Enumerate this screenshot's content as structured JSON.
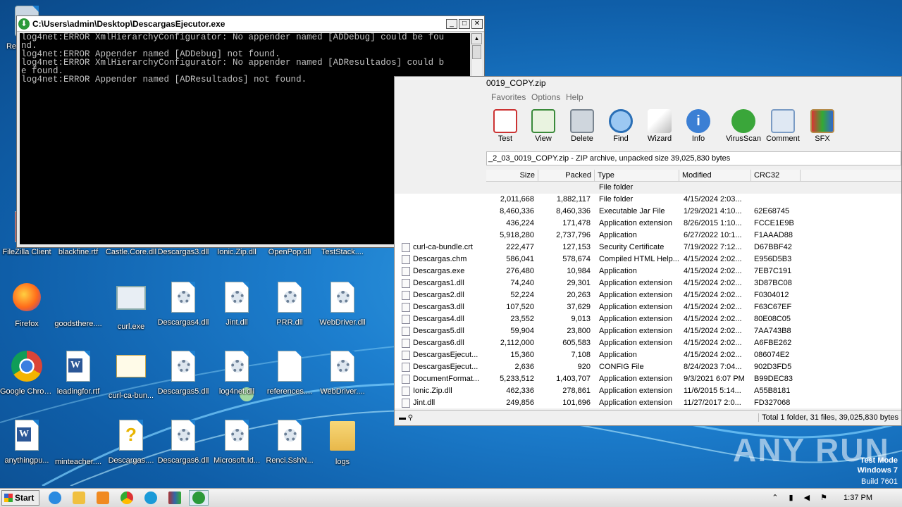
{
  "console": {
    "title": "C:\\Users\\admin\\Desktop\\DescargasEjecutor.exe",
    "output": "log4net:ERROR XmlHierarchyConfigurator: No appender named [ADDebug] could be fou\nnd.\nlog4net:ERROR Appender named [ADDebug] not found.\nlog4net:ERROR XmlHierarchyConfigurator: No appender named [ADResultados] could b\ne found.\nlog4net:ERROR Appender named [ADResultados] not found.",
    "buttons": [
      "_",
      "□",
      "✕"
    ]
  },
  "winrar": {
    "title": "0019_COPY.zip",
    "menu": [
      "Favorites",
      "Options",
      "Help"
    ],
    "toolbar": [
      "Test",
      "View",
      "Delete",
      "Find",
      "Wizard",
      "Info",
      "VirusScan",
      "Comment",
      "SFX"
    ],
    "path": "_2_03_0019_COPY.zip - ZIP archive, unpacked size 39,025,830 bytes",
    "columns": [
      "Size",
      "Packed",
      "Type",
      "Modified",
      "CRC32"
    ],
    "rows": [
      {
        "name": "",
        "size": "",
        "packed": "",
        "type": "File folder",
        "modified": "",
        "crc": ""
      },
      {
        "name": "",
        "size": "2,011,668",
        "packed": "1,882,117",
        "type": "File folder",
        "modified": "4/15/2024 2:03...",
        "crc": ""
      },
      {
        "name": "",
        "size": "8,460,336",
        "packed": "8,460,336",
        "type": "Executable Jar File",
        "modified": "1/29/2021 4:10...",
        "crc": "62E68745"
      },
      {
        "name": "",
        "size": "436,224",
        "packed": "171,478",
        "type": "Application extension",
        "modified": "8/26/2015 1:10...",
        "crc": "FCCE1E9B"
      },
      {
        "name": "",
        "size": "5,918,280",
        "packed": "2,737,796",
        "type": "Application",
        "modified": "6/27/2022 10:1...",
        "crc": "F1AAAD88"
      },
      {
        "name": "curl-ca-bundle.crt",
        "size": "222,477",
        "packed": "127,153",
        "type": "Security Certificate",
        "modified": "7/19/2022 7:12...",
        "crc": "D67BBF42"
      },
      {
        "name": "Descargas.chm",
        "size": "586,041",
        "packed": "578,674",
        "type": "Compiled HTML Help...",
        "modified": "4/15/2024 2:02...",
        "crc": "E956D5B3"
      },
      {
        "name": "Descargas.exe",
        "size": "276,480",
        "packed": "10,984",
        "type": "Application",
        "modified": "4/15/2024 2:02...",
        "crc": "7EB7C191"
      },
      {
        "name": "Descargas1.dll",
        "size": "74,240",
        "packed": "29,301",
        "type": "Application extension",
        "modified": "4/15/2024 2:02...",
        "crc": "3D87BC08"
      },
      {
        "name": "Descargas2.dll",
        "size": "52,224",
        "packed": "20,263",
        "type": "Application extension",
        "modified": "4/15/2024 2:02...",
        "crc": "F0304012"
      },
      {
        "name": "Descargas3.dll",
        "size": "107,520",
        "packed": "37,629",
        "type": "Application extension",
        "modified": "4/15/2024 2:02...",
        "crc": "F63C67EF"
      },
      {
        "name": "Descargas4.dll",
        "size": "23,552",
        "packed": "9,013",
        "type": "Application extension",
        "modified": "4/15/2024 2:02...",
        "crc": "80E08C05"
      },
      {
        "name": "Descargas5.dll",
        "size": "59,904",
        "packed": "23,800",
        "type": "Application extension",
        "modified": "4/15/2024 2:02...",
        "crc": "7AA743B8"
      },
      {
        "name": "Descargas6.dll",
        "size": "2,112,000",
        "packed": "605,583",
        "type": "Application extension",
        "modified": "4/15/2024 2:02...",
        "crc": "A6FBE262"
      },
      {
        "name": "DescargasEjecut...",
        "size": "15,360",
        "packed": "7,108",
        "type": "Application",
        "modified": "4/15/2024 2:02...",
        "crc": "086074E2"
      },
      {
        "name": "DescargasEjecut...",
        "size": "2,636",
        "packed": "920",
        "type": "CONFIG File",
        "modified": "8/24/2023 7:04...",
        "crc": "902D3FD5"
      },
      {
        "name": "DocumentFormat...",
        "size": "5,233,512",
        "packed": "1,403,707",
        "type": "Application extension",
        "modified": "9/3/2021 6:07 PM",
        "crc": "B99DEC83"
      },
      {
        "name": "Ionic.Zip.dll",
        "size": "462,336",
        "packed": "278,861",
        "type": "Application extension",
        "modified": "11/6/2015 5:14...",
        "crc": "A55B8181"
      },
      {
        "name": "Jint.dll",
        "size": "249,856",
        "packed": "101,696",
        "type": "Application extension",
        "modified": "11/27/2017 2:0...",
        "crc": "FD327068"
      }
    ],
    "status": "Total 1 folder, 31 files, 39,025,830 bytes"
  },
  "desktop": {
    "icons": [
      {
        "label": "Recycle Bin",
        "kind": "bin",
        "col": 0,
        "row": 0
      },
      {
        "label": "FileZilla Client",
        "kind": "app",
        "col": 0,
        "row": 3
      },
      {
        "label": "blackfine.rtf",
        "kind": "doc",
        "col": 1,
        "row": 3
      },
      {
        "label": "Castle.Core.dll",
        "kind": "dll",
        "col": 2,
        "row": 3
      },
      {
        "label": "Descargas3.dll",
        "kind": "dll",
        "col": 3,
        "row": 3
      },
      {
        "label": "Ionic.Zip.dll",
        "kind": "dll",
        "col": 4,
        "row": 3
      },
      {
        "label": "OpenPop.dll",
        "kind": "dll",
        "col": 5,
        "row": 3
      },
      {
        "label": "TestStack....",
        "kind": "dll",
        "col": 6,
        "row": 3
      },
      {
        "label": "Firefox",
        "kind": "firefox",
        "col": 0,
        "row": 4
      },
      {
        "label": "goodsthere....",
        "kind": "blank",
        "col": 1,
        "row": 4
      },
      {
        "label": "curl.exe",
        "kind": "exe",
        "col": 2,
        "row": 4
      },
      {
        "label": "Descargas4.dll",
        "kind": "dll",
        "col": 3,
        "row": 4
      },
      {
        "label": "Jint.dll",
        "kind": "dll",
        "col": 4,
        "row": 4
      },
      {
        "label": "PRR.dll",
        "kind": "dll",
        "col": 5,
        "row": 4
      },
      {
        "label": "WebDriver.dll",
        "kind": "dll",
        "col": 6,
        "row": 4
      },
      {
        "label": "Google Chrome",
        "kind": "chrome",
        "col": 0,
        "row": 5
      },
      {
        "label": "leadingfor.rtf",
        "kind": "word",
        "col": 1,
        "row": 5
      },
      {
        "label": "curl-ca-bun...",
        "kind": "cert",
        "col": 2,
        "row": 5
      },
      {
        "label": "Descargas5.dll",
        "kind": "dll",
        "col": 3,
        "row": 5
      },
      {
        "label": "log4net.dll",
        "kind": "dll",
        "col": 4,
        "row": 5
      },
      {
        "label": "references....",
        "kind": "doc",
        "col": 5,
        "row": 5
      },
      {
        "label": "WebDriver....",
        "kind": "dll",
        "col": 6,
        "row": 5
      },
      {
        "label": "anythingpu...",
        "kind": "word",
        "col": 0,
        "row": 6
      },
      {
        "label": "minteacher....",
        "kind": "blank",
        "col": 1,
        "row": 6
      },
      {
        "label": "Descargas....",
        "kind": "help",
        "col": 2,
        "row": 6
      },
      {
        "label": "Descargas6.dll",
        "kind": "dll",
        "col": 3,
        "row": 6
      },
      {
        "label": "Microsoft.Id...",
        "kind": "dll",
        "col": 4,
        "row": 6
      },
      {
        "label": "Renci.SshN...",
        "kind": "dll",
        "col": 5,
        "row": 6
      },
      {
        "label": "logs",
        "kind": "folder",
        "col": 6,
        "row": 6
      }
    ]
  },
  "taskbar": {
    "start": "Start",
    "clock": "1:37 PM",
    "apps": [
      "ie-icon",
      "explorer-icon",
      "media-icon",
      "chrome-icon",
      "edge-icon",
      "winrar-icon",
      "download-icon"
    ]
  },
  "watermark": {
    "line1": "Test Mode",
    "line2": "Windows 7",
    "line3": "Build 7601",
    "brand": "ANY RUN"
  }
}
